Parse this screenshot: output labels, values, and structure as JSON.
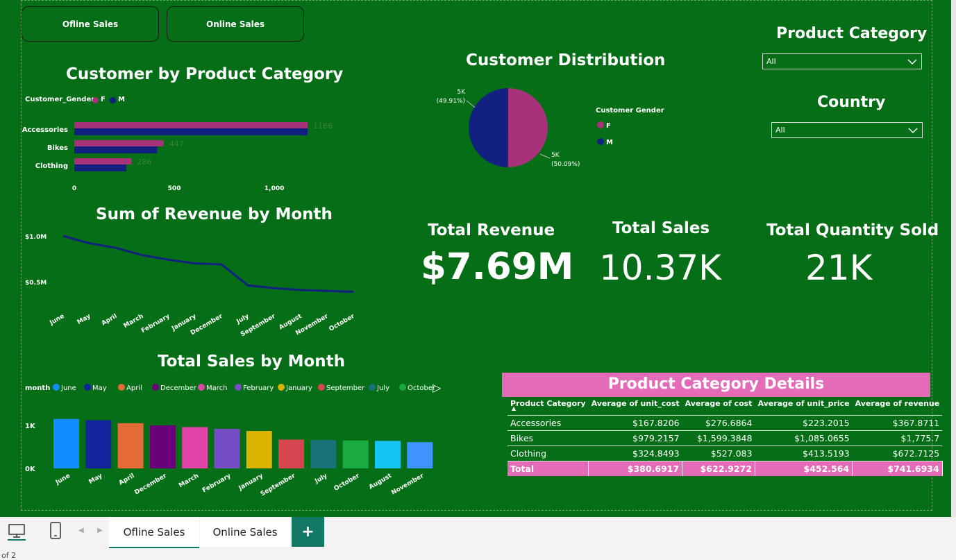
{
  "nav": {
    "offline_label": "Ofline Sales",
    "online_label": "Online Sales"
  },
  "bar_chart": {
    "title": "Customer by Product Category",
    "legend_title": "Customer_Gender",
    "legend_f": "F",
    "legend_m": "M",
    "colors": {
      "F": "#a83279",
      "M": "#12207f"
    }
  },
  "pie_chart": {
    "title": "Customer Distribution",
    "legend_title": "Customer Gender",
    "legend_f": "F",
    "legend_m": "M",
    "label_m_value": "5K",
    "label_m_pct": "(49.91%)",
    "label_f_value": "5K",
    "label_f_pct": "(50.09%)"
  },
  "line_chart": {
    "title": "Sum of Revenue by Month"
  },
  "month_bar_chart": {
    "title": "Total Sales by Month",
    "legend_title": "month"
  },
  "kpis": {
    "revenue_label": "Total Revenue",
    "revenue_value": "$7.69M",
    "sales_label": "Total Sales",
    "sales_value": "10.37K",
    "qty_label": "Total Quantity Sold",
    "qty_value": "21K"
  },
  "slicers": {
    "category_label": "Product Category",
    "category_value": "All",
    "country_label": "Country",
    "country_value": "All"
  },
  "table": {
    "title": "Product Category Details",
    "headers": [
      "Product Category",
      "Average of unit_cost",
      "Average of cost",
      "Average of unit_price",
      "Average of revenue"
    ],
    "rows": [
      [
        "Accessories",
        "$167.8206",
        "$276.6864",
        "$223.2015",
        "$367.8711"
      ],
      [
        "Bikes",
        "$979.2157",
        "$1,599.3848",
        "$1,085.0655",
        "$1,775.7"
      ],
      [
        "Clothing",
        "$324.8493",
        "$527.083",
        "$413.5193",
        "$672.7125"
      ]
    ],
    "total": [
      "Total",
      "$380.6917",
      "$622.9272",
      "$452.564",
      "$741.6934"
    ]
  },
  "tabs": {
    "tab1": "Ofline Sales",
    "tab2": "Online Sales",
    "add": "+"
  },
  "footer": {
    "page_text": "of 2"
  },
  "chart_data": [
    {
      "type": "bar",
      "title": "Customer by Product Category",
      "categories": [
        "Accessories",
        "Bikes",
        "Clothing"
      ],
      "series": [
        {
          "name": "F",
          "values": [
            1166,
            447,
            286
          ]
        },
        {
          "name": "M",
          "values": [
            1166,
            415,
            260
          ]
        }
      ],
      "data_labels": [
        "1166",
        "447",
        "286"
      ],
      "xticks": [
        "0",
        "500",
        "1,000"
      ],
      "xlim": [
        0,
        1250
      ]
    },
    {
      "type": "pie",
      "title": "Customer Distribution",
      "slices": [
        {
          "name": "F",
          "value": 50.09,
          "color": "#a83279"
        },
        {
          "name": "M",
          "value": 49.91,
          "color": "#12207f"
        }
      ]
    },
    {
      "type": "line",
      "title": "Sum of Revenue by Month",
      "categories": [
        "June",
        "May",
        "April",
        "March",
        "February",
        "January",
        "December",
        "July",
        "September",
        "August",
        "November",
        "October"
      ],
      "values": [
        1.0,
        0.92,
        0.87,
        0.79,
        0.74,
        0.7,
        0.69,
        0.46,
        0.43,
        0.41,
        0.4,
        0.39
      ],
      "yticks": [
        "$1.0M",
        "$0.5M"
      ],
      "ylim": [
        0,
        1.25
      ],
      "color": "#12207f"
    },
    {
      "type": "bar",
      "title": "Total Sales by Month",
      "categories": [
        "June",
        "May",
        "April",
        "December",
        "March",
        "February",
        "January",
        "September",
        "July",
        "October",
        "August",
        "November"
      ],
      "values": [
        1.15,
        1.12,
        1.05,
        1.0,
        0.96,
        0.92,
        0.87,
        0.67,
        0.66,
        0.65,
        0.64,
        0.61
      ],
      "colors": [
        "#118dff",
        "#12239e",
        "#e66c37",
        "#6b007b",
        "#e044a7",
        "#744ec2",
        "#d9b300",
        "#d64550",
        "#197278",
        "#1aab40",
        "#15c6f4",
        "#4092ff"
      ],
      "legend": [
        "June",
        "May",
        "April",
        "December",
        "March",
        "February",
        "January",
        "September",
        "July",
        "October"
      ],
      "yticks": [
        "1K",
        "0K"
      ],
      "ylim": [
        0,
        1.25
      ]
    }
  ]
}
